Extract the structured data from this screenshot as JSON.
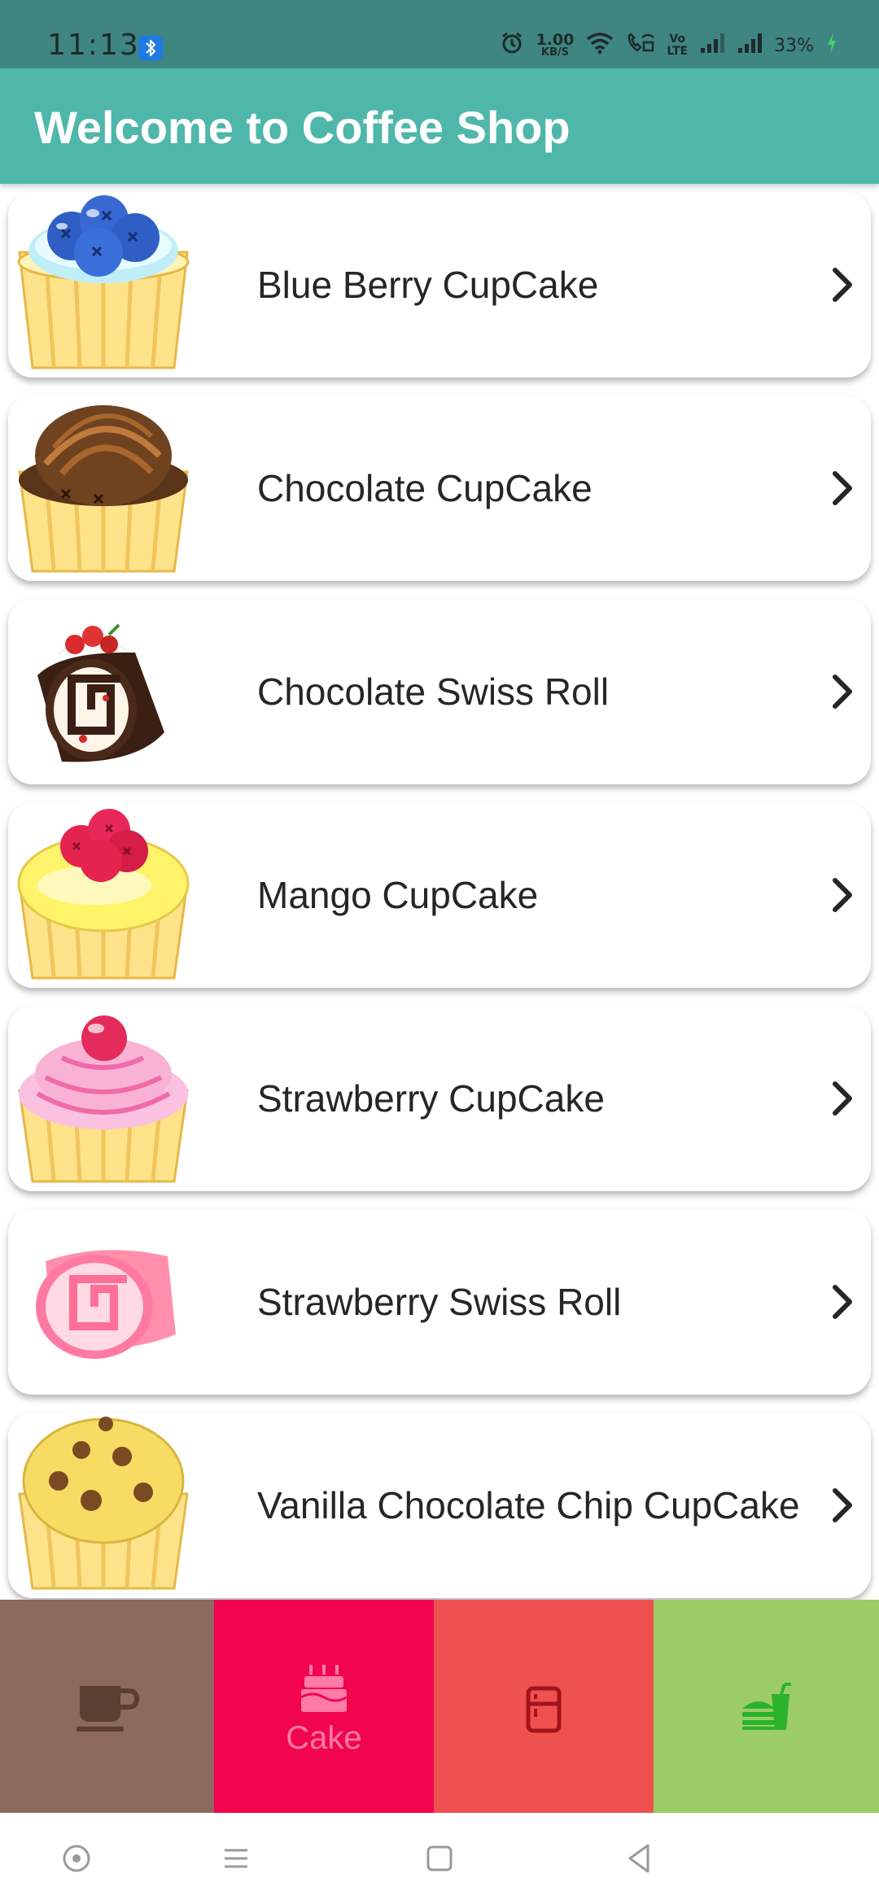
{
  "status_bar": {
    "time": "11:13",
    "network_speed_value": "1.00",
    "network_speed_unit": "KB/S",
    "volte_line1": "Vo",
    "volte_line2": "LTE",
    "battery": "33%",
    "icons": [
      "bluetooth-icon",
      "alarm-icon",
      "wifi-icon",
      "wifi-calling-icon",
      "volte-icon",
      "signal-icon",
      "signal-icon",
      "charging-icon"
    ]
  },
  "app_bar": {
    "title": "Welcome to Coffee Shop"
  },
  "items": [
    {
      "name": "Blue Berry CupCake",
      "image": "blueberry-cupcake-image"
    },
    {
      "name": "Chocolate CupCake",
      "image": "chocolate-cupcake-image"
    },
    {
      "name": "Chocolate Swiss Roll",
      "image": "chocolate-swiss-roll-image"
    },
    {
      "name": "Mango CupCake",
      "image": "mango-cupcake-image"
    },
    {
      "name": "Strawberry CupCake",
      "image": "strawberry-cupcake-image"
    },
    {
      "name": "Strawberry Swiss Roll",
      "image": "strawberry-swiss-roll-image"
    },
    {
      "name": "Vanilla Chocolate Chip CupCake",
      "image": "vanilla-chocolate-chip-cupcake-image"
    }
  ],
  "bottom_nav": {
    "tabs": [
      {
        "icon": "coffee-cup-icon",
        "label": "",
        "color": "#8c6a5e",
        "selected": false
      },
      {
        "icon": "birthday-cake-icon",
        "label": "Cake",
        "color": "#f2054f",
        "selected": true
      },
      {
        "icon": "fridge-icon",
        "label": "",
        "color": "#ef5151",
        "selected": false
      },
      {
        "icon": "fastfood-icon",
        "label": "",
        "color": "#9ccc65",
        "selected": false
      }
    ]
  },
  "system_nav": {
    "icons": [
      "assistant-icon",
      "recents-icon",
      "home-icon",
      "back-icon"
    ]
  },
  "colors": {
    "status_bar": "#3f8581",
    "app_bar": "#4fb6aa",
    "title_text": "#ffffff",
    "item_text": "#262626"
  }
}
